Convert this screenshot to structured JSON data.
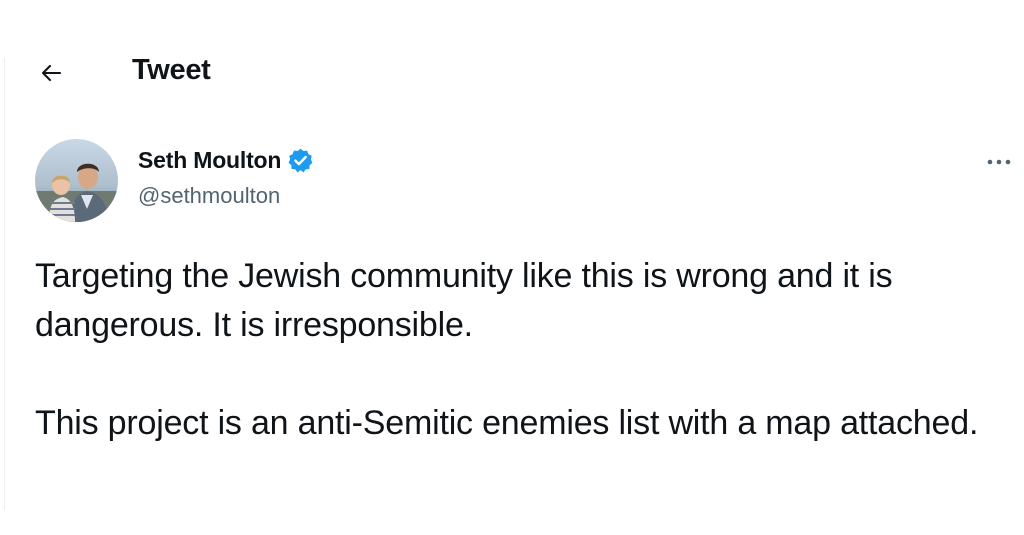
{
  "header": {
    "back_icon": "arrow-left-icon",
    "title": "Tweet"
  },
  "author": {
    "name": "Seth Moulton",
    "handle": "@sethmoulton",
    "verified_icon": "verified-badge-icon",
    "verified_color": "#1d9bf0",
    "avatar_icon": "profile-photo"
  },
  "more_icon": "more-horizontal-icon",
  "tweet": {
    "paragraphs": [
      "Targeting the Jewish community like this is wrong and it is dangerous.  It is irresponsible.",
      "This project is an anti-Semitic enemies list with a map attached."
    ]
  },
  "colors": {
    "text": "#0f1419",
    "secondary_text": "#536471",
    "accent": "#1d9bf0",
    "background": "#ffffff"
  }
}
